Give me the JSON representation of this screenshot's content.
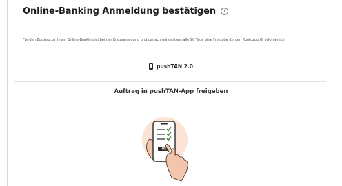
{
  "header": {
    "title": "Online-Banking Anmeldung bestätigen",
    "info_icon_glyph": "i"
  },
  "description": "Für den Zugang zu Ihrem Online-Banking ist bei der Erstanmeldung und danach mindestens alle 90 Tage eine Freigabe für den Kontozugriff erforderlich.",
  "method": {
    "icon": "smartphone-icon",
    "label": "pushTAN 2.0"
  },
  "instruction": "Auftrag in pushTAN-App freigeben",
  "illustration": {
    "icon": "phone-approval-illustration",
    "button_text": "OK",
    "colors": {
      "circle": "#fbe3d5",
      "hand": "#f3c6ac",
      "check": "#3f8f3b"
    }
  }
}
